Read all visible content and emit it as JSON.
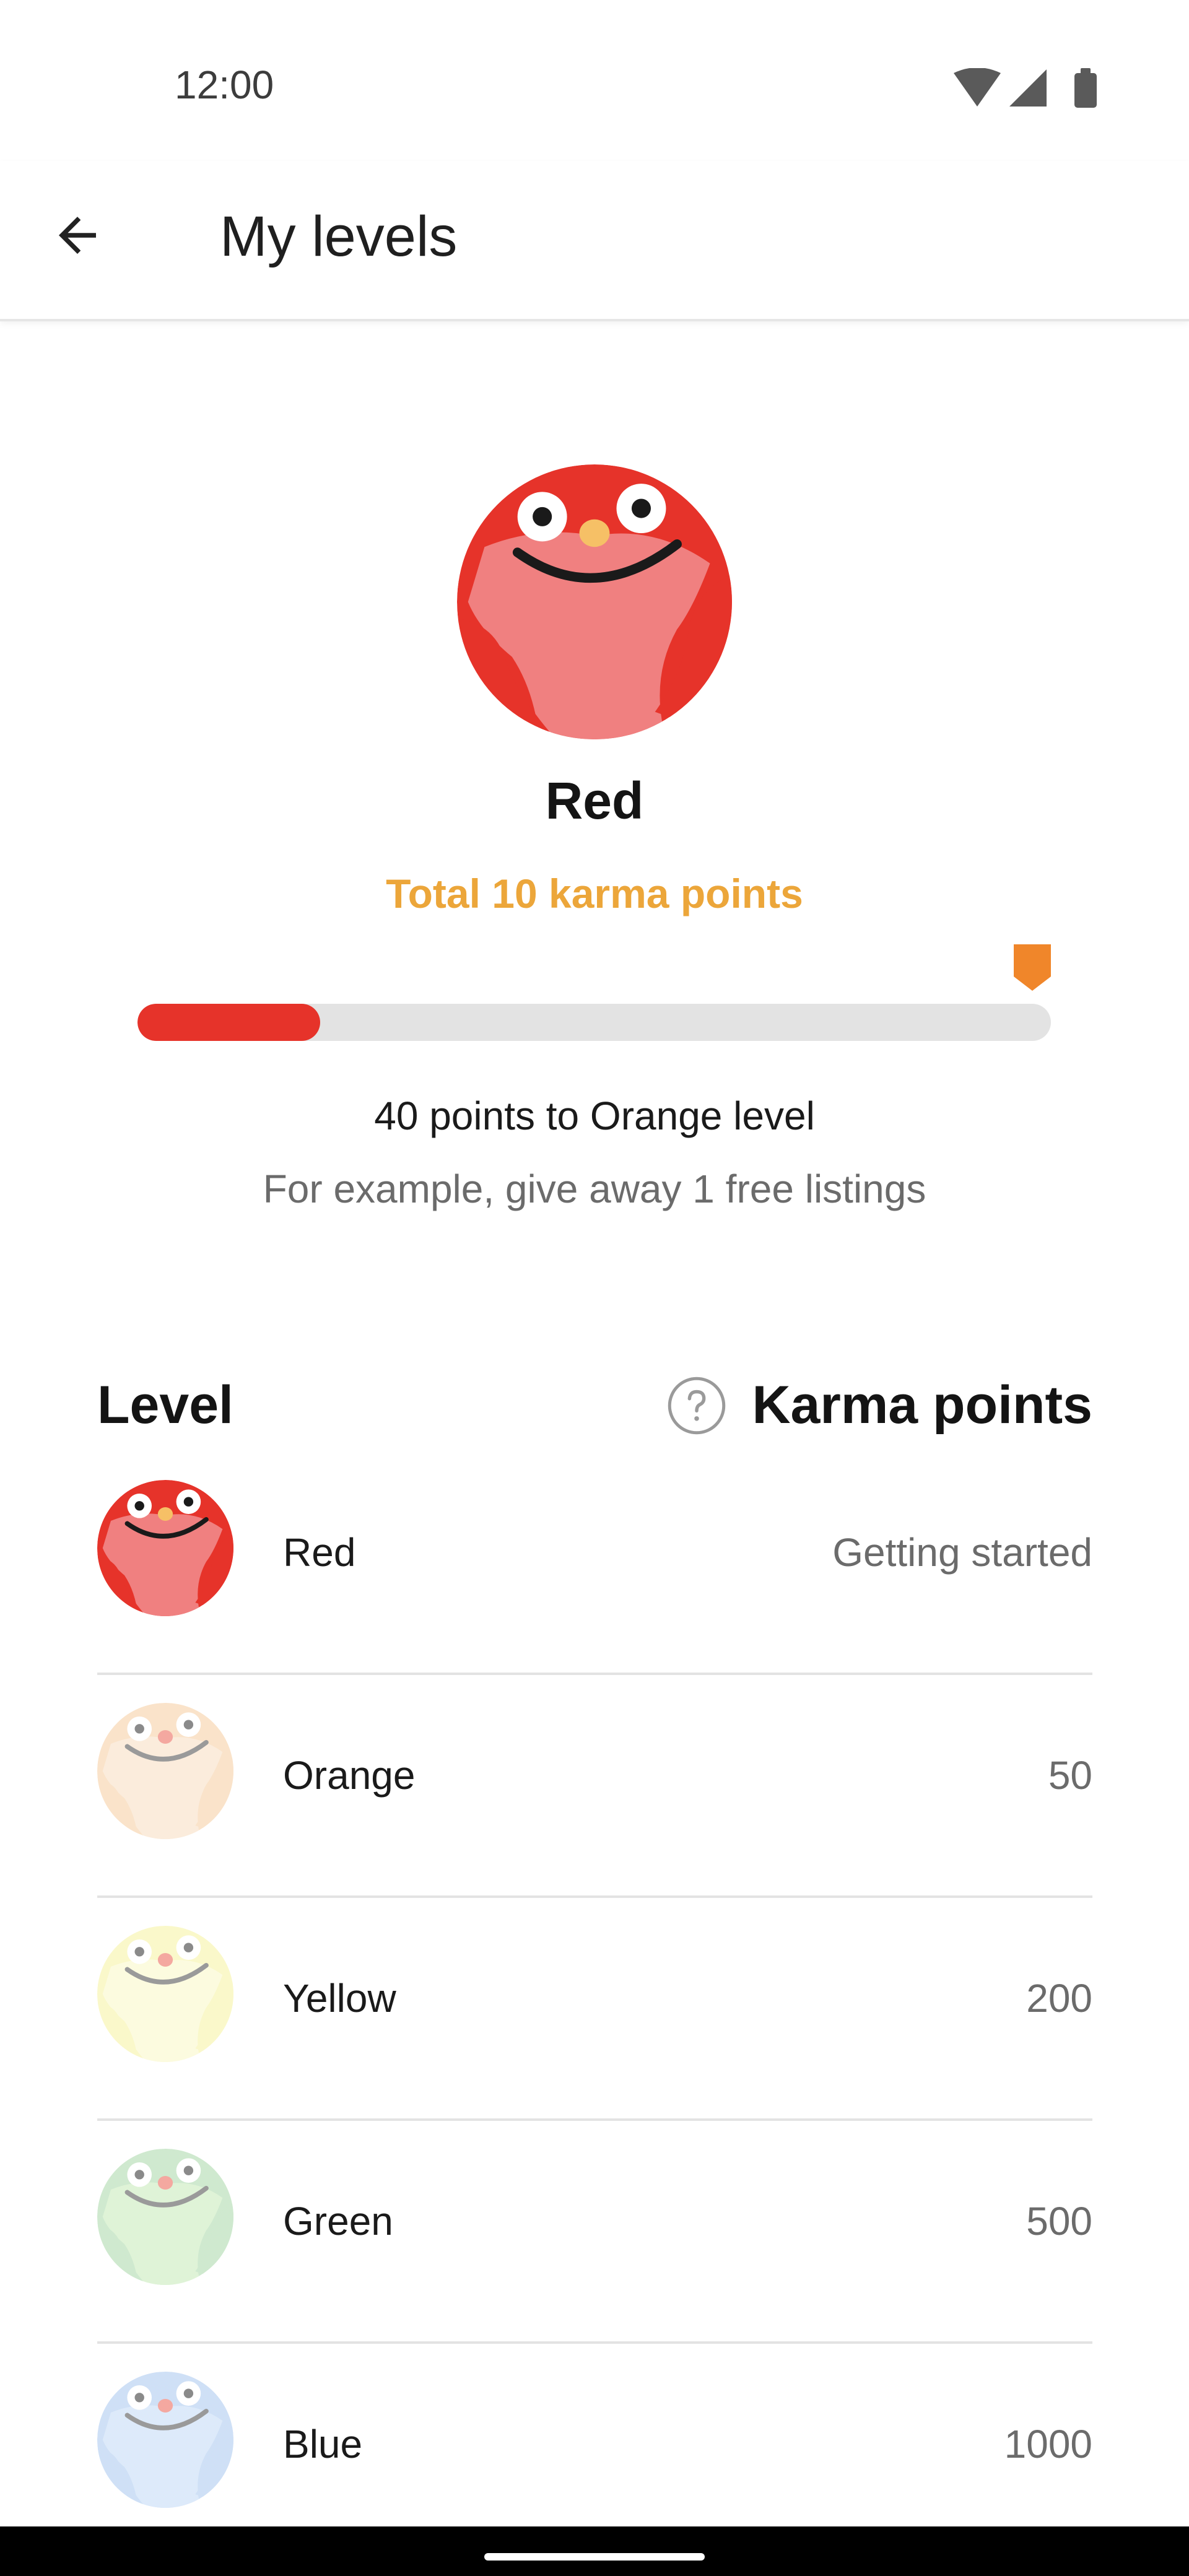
{
  "status_bar": {
    "time": "12:00",
    "icons": [
      "wifi-icon",
      "cellular-signal-icon",
      "battery-icon"
    ]
  },
  "app_bar": {
    "title": "My levels",
    "back_icon": "arrow-left-icon"
  },
  "current_level": {
    "name": "Red",
    "total_label": "Total 10 karma points",
    "progress_fraction": 0.2,
    "points_to_next": "40 points to Orange level",
    "example": "For example, give away 1 free listings"
  },
  "table": {
    "level_header": "Level",
    "karma_header": "Karma points",
    "help_icon": "question-circle-icon"
  },
  "levels": [
    {
      "name": "Red",
      "points": "Getting started",
      "color": "#E6332A",
      "light": "#F08080",
      "active": true
    },
    {
      "name": "Orange",
      "points": "50",
      "color": "#F6CDA0",
      "light": "#F8DEC0",
      "active": false
    },
    {
      "name": "Yellow",
      "points": "200",
      "color": "#F6F3A0",
      "light": "#FAF8C6",
      "active": false
    },
    {
      "name": "Green",
      "points": "500",
      "color": "#A8D8A8",
      "light": "#C5EBB8",
      "active": false
    },
    {
      "name": "Blue",
      "points": "1000",
      "color": "#A8C8F0",
      "light": "#C2DAF6",
      "active": false
    }
  ],
  "colors": {
    "accent_orange": "#ECA63A",
    "marker_orange": "#F0862A",
    "progress_red": "#E6332A"
  }
}
